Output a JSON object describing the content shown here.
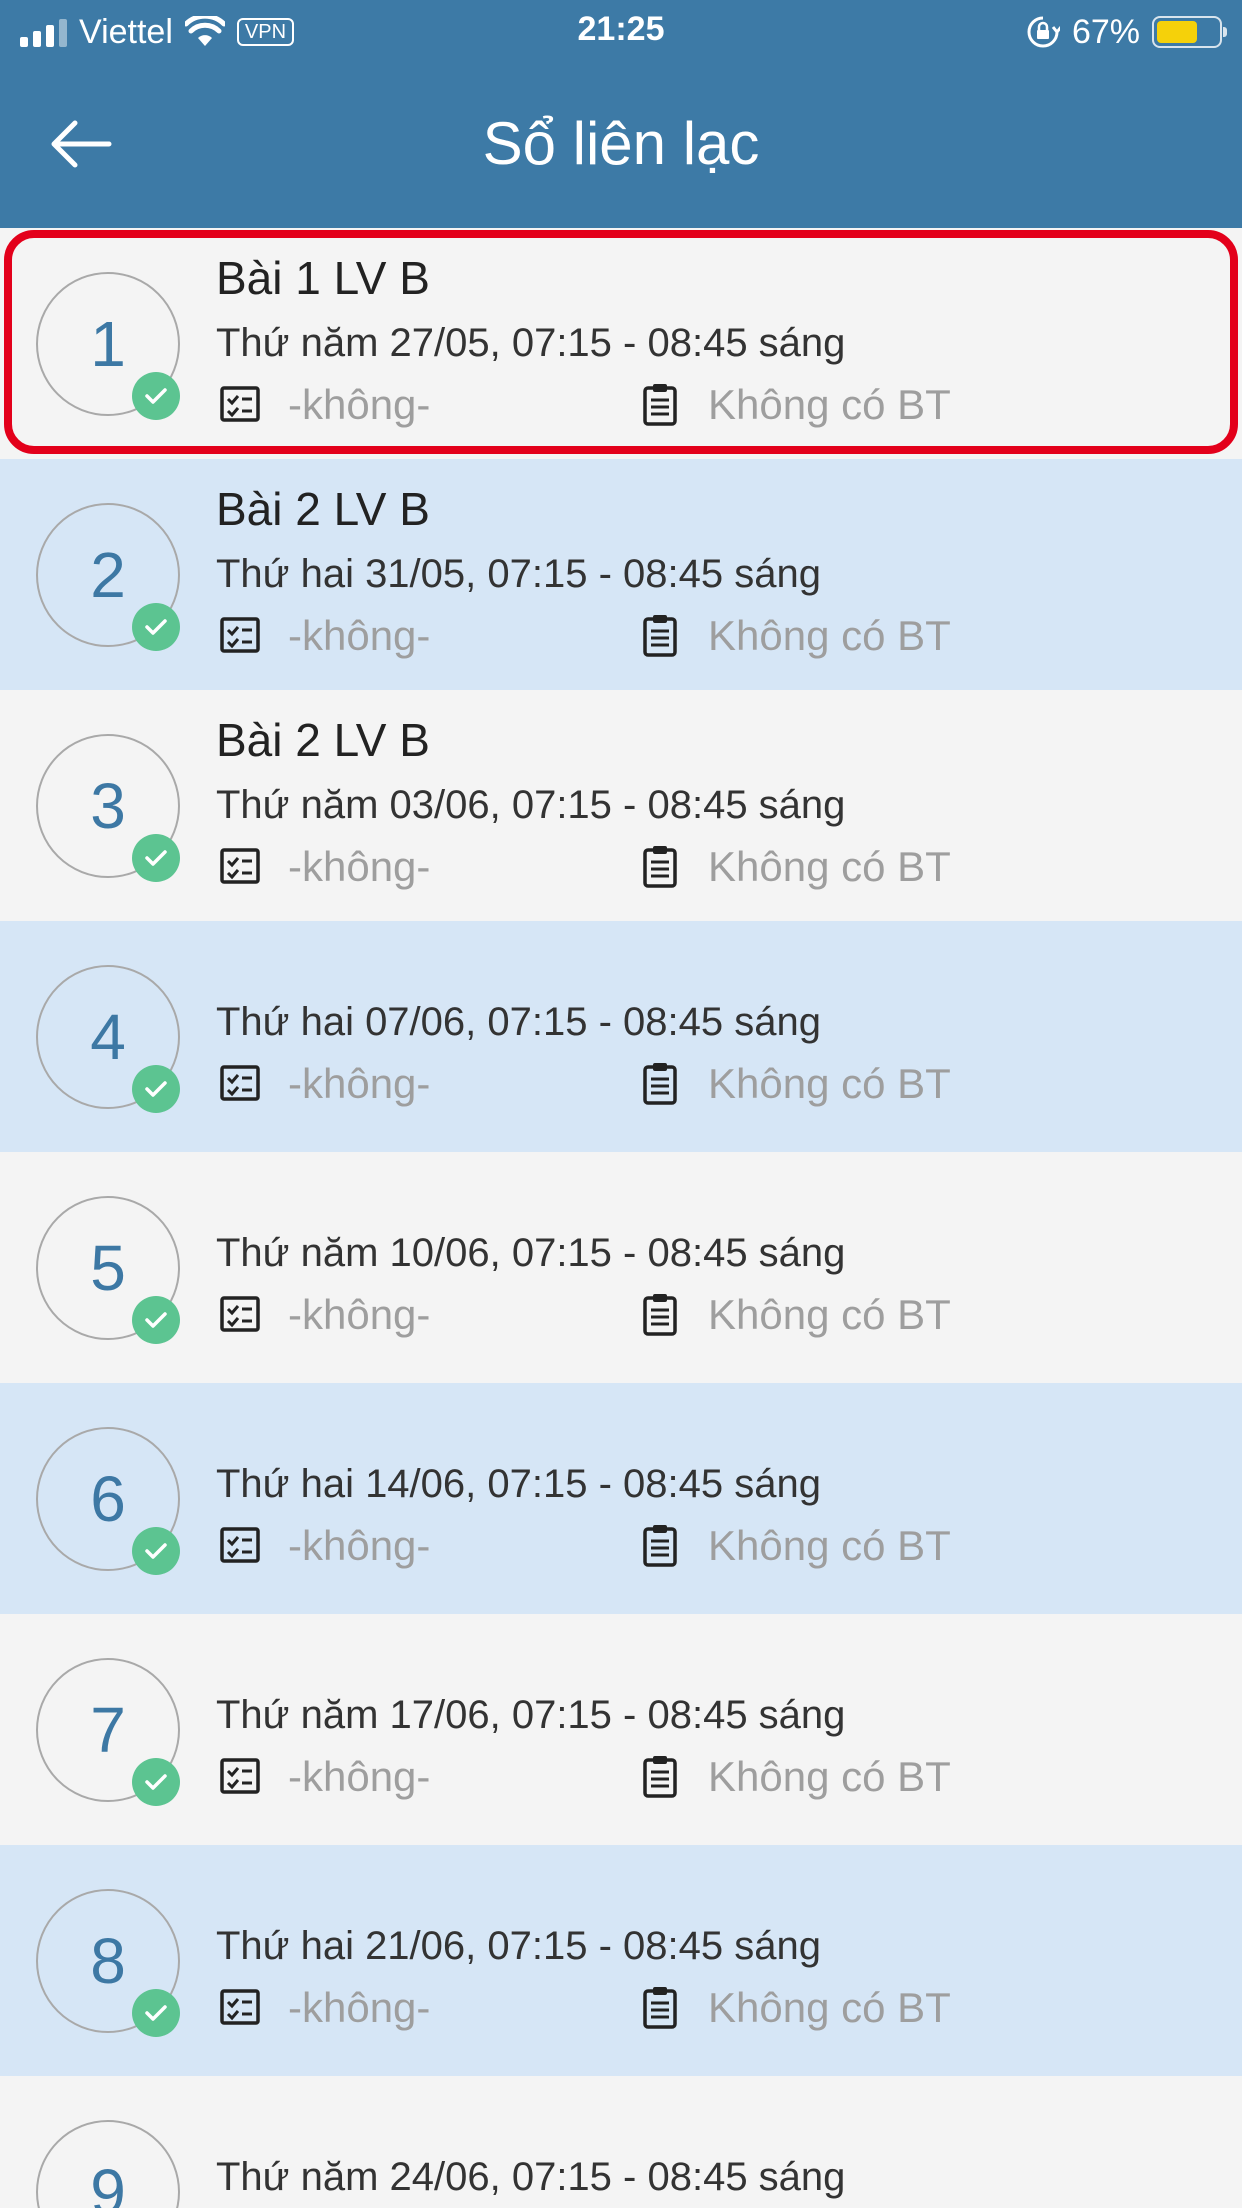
{
  "status_bar": {
    "carrier": "Viettel",
    "vpn_label": "VPN",
    "time": "21:25",
    "battery_percent": "67%",
    "battery_level": 0.67
  },
  "header": {
    "title": "Sổ liên lạc",
    "back_icon": "arrow-left-icon"
  },
  "lessons": [
    {
      "number": "1",
      "title": "Bài 1 LV B",
      "time": "Thứ năm 27/05, 07:15 - 08:45 sáng",
      "evaluation": "-không-",
      "homework": "Không có BT",
      "completed": true,
      "highlighted": true
    },
    {
      "number": "2",
      "title": "Bài 2 LV B",
      "time": "Thứ hai 31/05, 07:15 - 08:45 sáng",
      "evaluation": "-không-",
      "homework": "Không có BT",
      "completed": true
    },
    {
      "number": "3",
      "title": "Bài 2 LV B",
      "time": "Thứ năm 03/06, 07:15 - 08:45 sáng",
      "evaluation": "-không-",
      "homework": "Không có BT",
      "completed": true
    },
    {
      "number": "4",
      "title": "",
      "time": "Thứ hai 07/06, 07:15 - 08:45 sáng",
      "evaluation": "-không-",
      "homework": "Không có BT",
      "completed": true
    },
    {
      "number": "5",
      "title": "",
      "time": "Thứ năm 10/06, 07:15 - 08:45 sáng",
      "evaluation": "-không-",
      "homework": "Không có BT",
      "completed": true
    },
    {
      "number": "6",
      "title": "",
      "time": "Thứ hai 14/06, 07:15 - 08:45 sáng",
      "evaluation": "-không-",
      "homework": "Không có BT",
      "completed": true
    },
    {
      "number": "7",
      "title": "",
      "time": "Thứ năm 17/06, 07:15 - 08:45 sáng",
      "evaluation": "-không-",
      "homework": "Không có BT",
      "completed": true
    },
    {
      "number": "8",
      "title": "",
      "time": "Thứ hai 21/06, 07:15 - 08:45 sáng",
      "evaluation": "-không-",
      "homework": "Không có BT",
      "completed": true
    },
    {
      "number": "9",
      "title": "",
      "time": "Thứ năm 24/06, 07:15 - 08:45 sáng",
      "evaluation": "",
      "homework": "",
      "completed": false
    }
  ],
  "colors": {
    "header_bg": "#3d7aa6",
    "row_light": "#f4f4f4",
    "row_blue": "#d6e6f6",
    "number_color": "#3d78a4",
    "check_green": "#5cc491",
    "highlight_red": "#e3001b"
  },
  "icons": {
    "evaluation": "checklist-icon",
    "homework": "clipboard-icon",
    "completed": "check-badge-icon"
  }
}
